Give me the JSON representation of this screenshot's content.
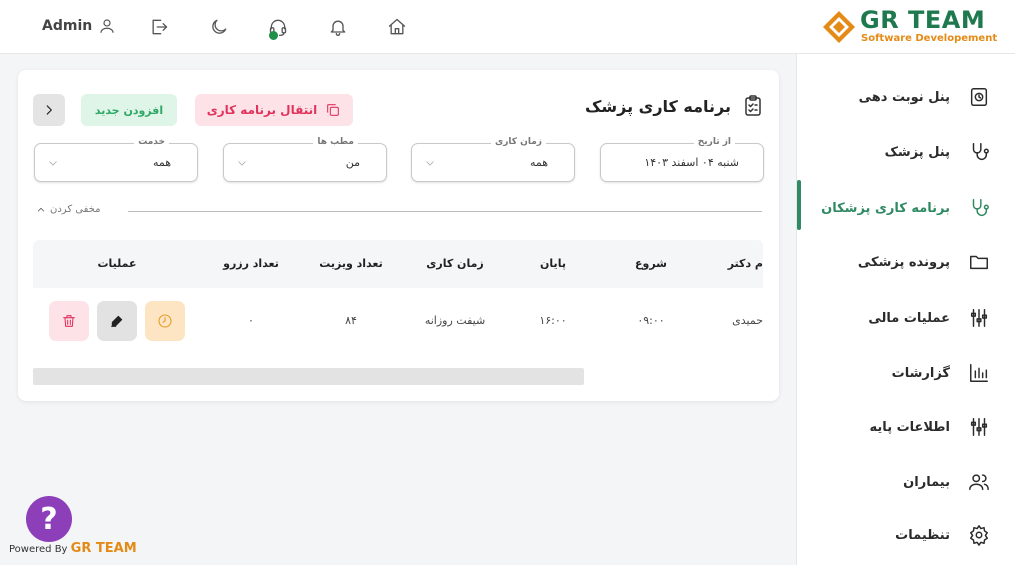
{
  "header": {
    "user_name": "Admin",
    "logo_title": "GR TEAM",
    "logo_subtitle": "Software Developement"
  },
  "sidebar": {
    "items": [
      {
        "label": "پنل نوبت دهی",
        "icon": "clock-panel-icon"
      },
      {
        "label": "پنل پزشک",
        "icon": "stethoscope-icon"
      },
      {
        "label": "برنامه کاری پزشکان",
        "icon": "stethoscope-icon",
        "active": true
      },
      {
        "label": "پرونده پزشکی",
        "icon": "folder-icon"
      },
      {
        "label": "عملیات مالی",
        "icon": "sliders-icon"
      },
      {
        "label": "گزارشات",
        "icon": "bar-chart-icon"
      },
      {
        "label": "اطلاعات پایه",
        "icon": "sliders-icon"
      },
      {
        "label": "بیماران",
        "icon": "users-icon"
      },
      {
        "label": "تنظیمات",
        "icon": "gear-icon"
      }
    ],
    "accent": "#2f8a63"
  },
  "main": {
    "title": "برنامه کاری پزشک",
    "transfer_label": "انتقال برنامه کاری",
    "add_label": "افزودن جدید",
    "filters": {
      "from_date": {
        "label": "از تاریخ",
        "value": "شنبه ۰۴ اسفند ۱۴۰۳"
      },
      "work_time": {
        "label": "زمان کاری",
        "value": "همه"
      },
      "clinics": {
        "label": "مطب ها",
        "value": "من"
      },
      "service": {
        "label": "خدمت",
        "value": "همه"
      }
    },
    "hide_label": "مخفی کردن",
    "table": {
      "headers": {
        "doctor": "م دکتر",
        "start": "شروع",
        "end": "پایان",
        "work_time": "زمان کاری",
        "visits": "تعداد ویزیت",
        "reservations": "تعداد رزرو",
        "actions": "عملیات"
      },
      "rows": [
        {
          "doctor": "حمیدی",
          "start": "۰۹:۰۰",
          "end": "۱۶:۰۰",
          "work_time": "شیفت روزانه",
          "visits": "۸۴",
          "reservations": "۰"
        }
      ]
    }
  },
  "footer": {
    "help_symbol": "?",
    "powered_prefix": "Powered By",
    "powered_brand": "GR TEAM"
  }
}
